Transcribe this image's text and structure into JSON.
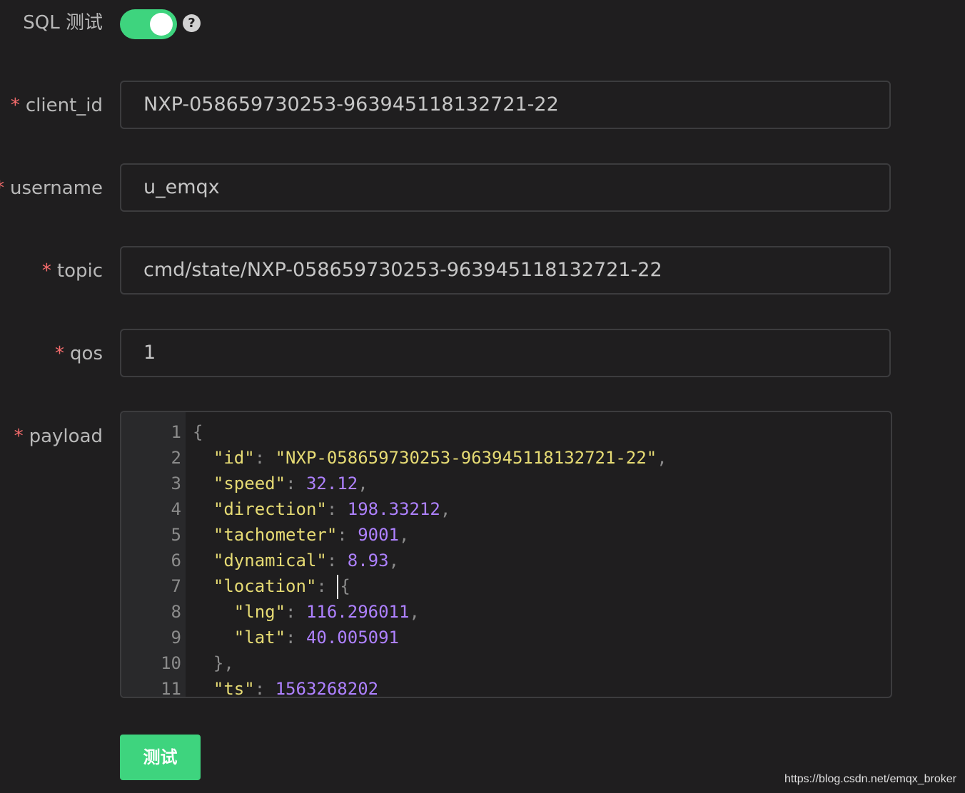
{
  "sql_test": {
    "label": "SQL 测试",
    "enabled": true,
    "help_glyph": "?"
  },
  "required_mark": "*",
  "fields": {
    "client_id": {
      "label": "client_id",
      "value": "NXP-058659730253-963945118132721-22"
    },
    "username": {
      "label": "username",
      "value": "u_emqx"
    },
    "topic": {
      "label": "topic",
      "value": "cmd/state/NXP-058659730253-963945118132721-22"
    },
    "qos": {
      "label": "qos",
      "value": "1"
    },
    "payload": {
      "label": "payload"
    }
  },
  "editor": {
    "line_numbers": [
      "1",
      "2",
      "3",
      "4",
      "5",
      "6",
      "7",
      "8",
      "9",
      "10",
      "11"
    ],
    "lines": [
      [
        {
          "t": "punc",
          "v": "{"
        }
      ],
      [
        {
          "t": "ws",
          "v": "  "
        },
        {
          "t": "key",
          "v": "\"id\""
        },
        {
          "t": "punc",
          "v": ": "
        },
        {
          "t": "str",
          "v": "\"NXP-058659730253-963945118132721-22\""
        },
        {
          "t": "punc",
          "v": ","
        }
      ],
      [
        {
          "t": "ws",
          "v": "  "
        },
        {
          "t": "key",
          "v": "\"speed\""
        },
        {
          "t": "punc",
          "v": ": "
        },
        {
          "t": "num",
          "v": "32.12"
        },
        {
          "t": "punc",
          "v": ","
        }
      ],
      [
        {
          "t": "ws",
          "v": "  "
        },
        {
          "t": "key",
          "v": "\"direction\""
        },
        {
          "t": "punc",
          "v": ": "
        },
        {
          "t": "num",
          "v": "198.33212"
        },
        {
          "t": "punc",
          "v": ","
        }
      ],
      [
        {
          "t": "ws",
          "v": "  "
        },
        {
          "t": "key",
          "v": "\"tachometer\""
        },
        {
          "t": "punc",
          "v": ": "
        },
        {
          "t": "num",
          "v": "9001"
        },
        {
          "t": "punc",
          "v": ","
        }
      ],
      [
        {
          "t": "ws",
          "v": "  "
        },
        {
          "t": "key",
          "v": "\"dynamical\""
        },
        {
          "t": "punc",
          "v": ": "
        },
        {
          "t": "num",
          "v": "8.93"
        },
        {
          "t": "punc",
          "v": ","
        }
      ],
      [
        {
          "t": "ws",
          "v": "  "
        },
        {
          "t": "key",
          "v": "\"location\""
        },
        {
          "t": "punc",
          "v": ": "
        },
        {
          "t": "cursor",
          "v": ""
        },
        {
          "t": "punc",
          "v": "{"
        }
      ],
      [
        {
          "t": "ws",
          "v": "    "
        },
        {
          "t": "key",
          "v": "\"lng\""
        },
        {
          "t": "punc",
          "v": ": "
        },
        {
          "t": "num",
          "v": "116.296011"
        },
        {
          "t": "punc",
          "v": ","
        }
      ],
      [
        {
          "t": "ws",
          "v": "    "
        },
        {
          "t": "key",
          "v": "\"lat\""
        },
        {
          "t": "punc",
          "v": ": "
        },
        {
          "t": "num",
          "v": "40.005091"
        }
      ],
      [
        {
          "t": "ws",
          "v": "  "
        },
        {
          "t": "punc",
          "v": "},"
        }
      ],
      [
        {
          "t": "ws",
          "v": "  "
        },
        {
          "t": "key",
          "v": "\"ts\""
        },
        {
          "t": "punc",
          "v": ": "
        },
        {
          "t": "num",
          "v": "1563268202"
        }
      ]
    ]
  },
  "test_button": {
    "label": "测试"
  },
  "watermark": "https://blog.csdn.net/emqx_broker",
  "colors": {
    "accent": "#3ed47e",
    "required": "#f56c6c",
    "json_key": "#e6db74",
    "json_number": "#ae81ff"
  }
}
